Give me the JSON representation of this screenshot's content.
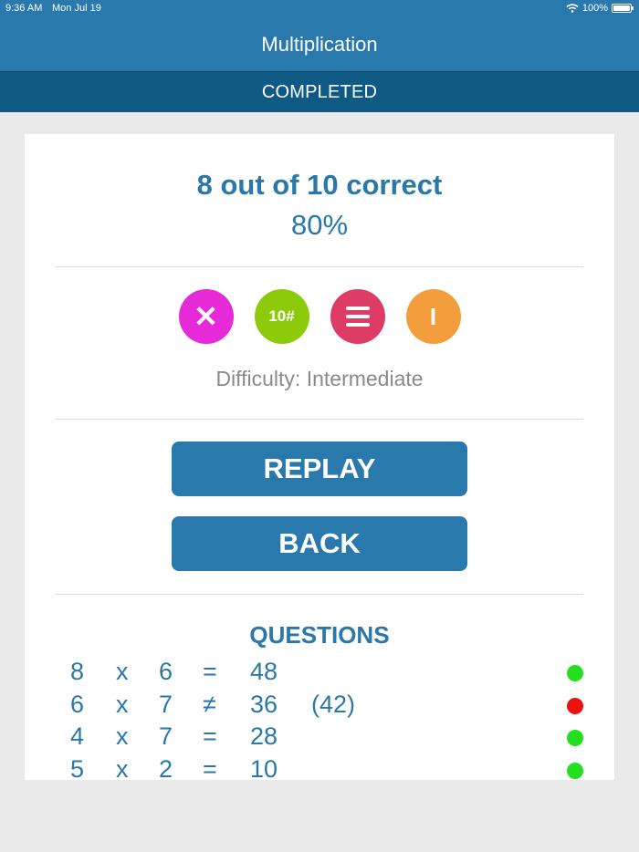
{
  "status_bar": {
    "time": "9:36 AM",
    "date": "Mon Jul 19",
    "battery": "100%"
  },
  "nav": {
    "title": "Multiplication"
  },
  "subheader": {
    "label": "COMPLETED"
  },
  "result": {
    "score_text": "8 out of 10 correct",
    "percent": "80%"
  },
  "settings_icons": [
    {
      "name": "multiply-icon",
      "glyph": "✕",
      "color": "#e62ad7"
    },
    {
      "name": "question-count-icon",
      "glyph": "10#",
      "color": "#8dcb0a"
    },
    {
      "name": "list-icon",
      "glyph": "",
      "color": "#dc3c66"
    },
    {
      "name": "difficulty-level-icon",
      "glyph": "I",
      "color": "#f39e3d"
    }
  ],
  "difficulty_text": "Difficulty: Intermediate",
  "buttons": {
    "replay": "REPLAY",
    "back": "BACK"
  },
  "questions": {
    "title": "QUESTIONS",
    "items": [
      {
        "a": "8",
        "op": "x",
        "b": "6",
        "eq": "=",
        "answer": "48",
        "correct_answer": "",
        "status": "correct"
      },
      {
        "a": "6",
        "op": "x",
        "b": "7",
        "eq": "≠",
        "answer": "36",
        "correct_answer": "(42)",
        "status": "incorrect"
      },
      {
        "a": "4",
        "op": "x",
        "b": "7",
        "eq": "=",
        "answer": "28",
        "correct_answer": "",
        "status": "correct"
      },
      {
        "a": "5",
        "op": "x",
        "b": "2",
        "eq": "=",
        "answer": "10",
        "correct_answer": "",
        "status": "correct"
      }
    ]
  },
  "colors": {
    "primary": "#2979ad",
    "dark_primary": "#0f5a85",
    "correct": "#22e01f",
    "incorrect": "#ee1111"
  }
}
